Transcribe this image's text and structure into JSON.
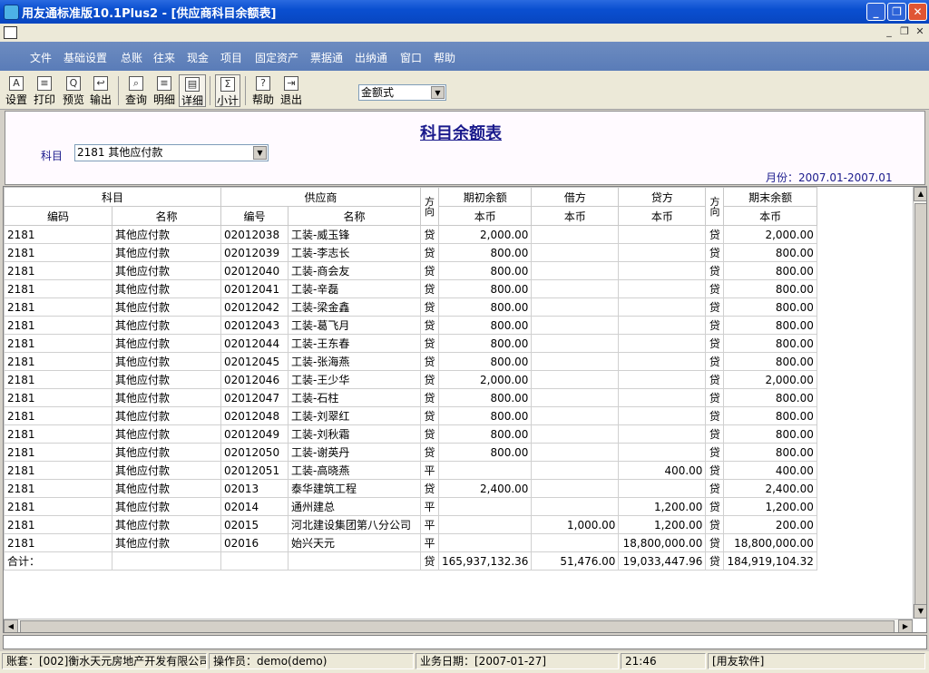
{
  "window": {
    "title": "用友通标准版10.1Plus2 - [供应商科目余额表]"
  },
  "menu": [
    "文件",
    "基础设置",
    "总账",
    "往来",
    "现金",
    "项目",
    "固定资产",
    "票据通",
    "出纳通",
    "窗口",
    "帮助"
  ],
  "toolbar": {
    "buttons": [
      {
        "label": "设置",
        "icon": "A"
      },
      {
        "label": "打印",
        "icon": "≡"
      },
      {
        "label": "预览",
        "icon": "Q"
      },
      {
        "label": "输出",
        "icon": "↩"
      },
      {
        "label": "查询",
        "icon": "⌕"
      },
      {
        "label": "明细",
        "icon": "≡"
      },
      {
        "label": "详细",
        "icon": "▤"
      },
      {
        "label": "小计",
        "icon": "Σ"
      },
      {
        "label": "帮助",
        "icon": "?"
      },
      {
        "label": "退出",
        "icon": "⇥"
      }
    ],
    "format_select": "金额式"
  },
  "report": {
    "title": "科目余额表",
    "subject_label": "科目",
    "subject_value": "2181 其他应付款",
    "period": "月份：2007.01-2007.01"
  },
  "table": {
    "group_headers": {
      "subject": "科目",
      "supplier": "供应商",
      "dir1": "方\n向",
      "opening": "期初余额",
      "debit": "借方",
      "credit": "贷方",
      "dir2": "方\n向",
      "closing": "期末余额"
    },
    "sub_headers": {
      "code": "编码",
      "name": "名称",
      "sup_code": "编号",
      "sup_name": "名称",
      "cur1": "本币",
      "cur2": "本币",
      "cur3": "本币",
      "cur4": "本币"
    },
    "rows": [
      [
        "2181",
        "其他应付款",
        "02012038",
        "工装-威玉锋",
        "贷",
        "2,000.00",
        "",
        "",
        "贷",
        "2,000.00"
      ],
      [
        "2181",
        "其他应付款",
        "02012039",
        "工装-李志长",
        "贷",
        "800.00",
        "",
        "",
        "贷",
        "800.00"
      ],
      [
        "2181",
        "其他应付款",
        "02012040",
        "工装-商会友",
        "贷",
        "800.00",
        "",
        "",
        "贷",
        "800.00"
      ],
      [
        "2181",
        "其他应付款",
        "02012041",
        "工装-辛磊",
        "贷",
        "800.00",
        "",
        "",
        "贷",
        "800.00"
      ],
      [
        "2181",
        "其他应付款",
        "02012042",
        "工装-梁金鑫",
        "贷",
        "800.00",
        "",
        "",
        "贷",
        "800.00"
      ],
      [
        "2181",
        "其他应付款",
        "02012043",
        "工装-葛飞月",
        "贷",
        "800.00",
        "",
        "",
        "贷",
        "800.00"
      ],
      [
        "2181",
        "其他应付款",
        "02012044",
        "工装-王东春",
        "贷",
        "800.00",
        "",
        "",
        "贷",
        "800.00"
      ],
      [
        "2181",
        "其他应付款",
        "02012045",
        "工装-张海燕",
        "贷",
        "800.00",
        "",
        "",
        "贷",
        "800.00"
      ],
      [
        "2181",
        "其他应付款",
        "02012046",
        "工装-王少华",
        "贷",
        "2,000.00",
        "",
        "",
        "贷",
        "2,000.00"
      ],
      [
        "2181",
        "其他应付款",
        "02012047",
        "工装-石柱",
        "贷",
        "800.00",
        "",
        "",
        "贷",
        "800.00"
      ],
      [
        "2181",
        "其他应付款",
        "02012048",
        "工装-刘翠红",
        "贷",
        "800.00",
        "",
        "",
        "贷",
        "800.00"
      ],
      [
        "2181",
        "其他应付款",
        "02012049",
        "工装-刘秋霜",
        "贷",
        "800.00",
        "",
        "",
        "贷",
        "800.00"
      ],
      [
        "2181",
        "其他应付款",
        "02012050",
        "工装-谢英丹",
        "贷",
        "800.00",
        "",
        "",
        "贷",
        "800.00"
      ],
      [
        "2181",
        "其他应付款",
        "02012051",
        "工装-高晓燕",
        "平",
        "",
        "",
        "400.00",
        "贷",
        "400.00"
      ],
      [
        "2181",
        "其他应付款",
        "02013",
        "泰华建筑工程",
        "贷",
        "2,400.00",
        "",
        "",
        "贷",
        "2,400.00"
      ],
      [
        "2181",
        "其他应付款",
        "02014",
        "通州建总",
        "平",
        "",
        "",
        "1,200.00",
        "贷",
        "1,200.00"
      ],
      [
        "2181",
        "其他应付款",
        "02015",
        "河北建设集团第八分公司",
        "平",
        "",
        "1,000.00",
        "1,200.00",
        "贷",
        "200.00"
      ],
      [
        "2181",
        "其他应付款",
        "02016",
        "始兴天元",
        "平",
        "",
        "",
        "18,800,000.00",
        "贷",
        "18,800,000.00"
      ],
      [
        "合计：",
        "",
        "",
        "",
        "贷",
        "165,937,132.36",
        "51,476.00",
        "19,033,447.96",
        "贷",
        "184,919,104.32"
      ]
    ]
  },
  "statusbar": {
    "account": "账套：[002]衡水天元房地产开发有限公司",
    "operator": "操作员：demo(demo)",
    "date": "业务日期：[2007-01-27]",
    "time": "21:46",
    "vendor": "[用友软件]"
  }
}
